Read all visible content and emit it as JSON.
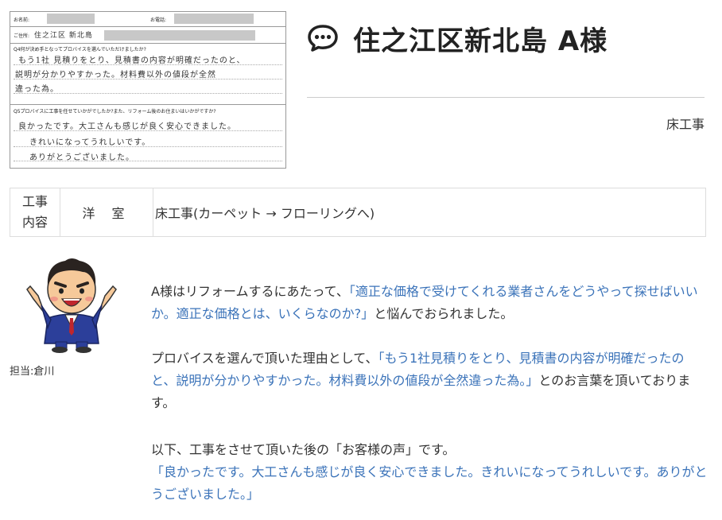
{
  "form": {
    "name_label": "お名前:",
    "phone_label": "お電話:",
    "address_label": "ご住所:",
    "address_value": "住之江区 新北島",
    "q4_label": "Q4何が決め手となってプロバイスを選んでいただけましたか?",
    "q4_answer_1": "もう1社 見積りをとり、見積書の内容が明確だったのと、",
    "q4_answer_2": "説明が分かりやすかった。材料費以外の値段が全然",
    "q4_answer_3": "違った為。",
    "q5_label": "Q5プロバイスに工事を任せていかがでしたか?また、リフォーム後のお住まいはいかがですか?",
    "q5_answer_1": "良かったです。大工さんも感じが良く安心できました。",
    "q5_answer_2": "きれいになってうれしいです。",
    "q5_answer_3": "ありがとうございました。"
  },
  "header": {
    "icon": "speech-bubble-icon",
    "title": "住之江区新北島 A様",
    "category": "床工事"
  },
  "work_table": {
    "head_line1": "工事",
    "head_line2": "内容",
    "room": "洋 室",
    "work": "床工事(カーペット → フローリングへ)"
  },
  "staff": {
    "label": "担当:倉川"
  },
  "body": {
    "p1_a": "A様はリフォームするにあたって、",
    "p1_quote": "「適正な価格で受けてくれる業者さんをどうやって探せばいいか。適正な価格とは、いくらなのか?」",
    "p1_b": "と悩んでおられました。",
    "p2_a": "プロバイスを選んで頂いた理由として、",
    "p2_quote": "「もう1社見積りをとり、見積書の内容が明確だったのと、説明が分かりやすかった。材料費以外の値段が全然違った為。」",
    "p2_b": "とのお言葉を頂いております。",
    "p3_a": "以下、工事をさせて頂いた後の「お客様の声」です。",
    "p3_quote": "「良かったです。大工さんも感じが良く安心できました。きれいになってうれしいです。ありがとうございました。」"
  },
  "colors": {
    "accent_blue": "#3b73b9",
    "text": "#333333"
  }
}
